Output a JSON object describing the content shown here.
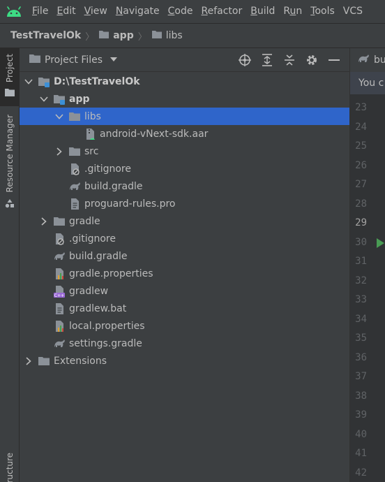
{
  "menu": {
    "items": [
      {
        "label": "File",
        "mnemonic": "F",
        "rest": "ile"
      },
      {
        "label": "Edit",
        "mnemonic": "E",
        "rest": "dit"
      },
      {
        "label": "View",
        "mnemonic": "V",
        "rest": "iew"
      },
      {
        "label": "Navigate",
        "mnemonic": "N",
        "rest": "avigate"
      },
      {
        "label": "Code",
        "mnemonic": "C",
        "rest": "ode"
      },
      {
        "label": "Refactor",
        "mnemonic": "R",
        "rest": "efactor"
      },
      {
        "label": "Build",
        "mnemonic": "B",
        "rest": "uild"
      },
      {
        "label": "Run",
        "pre": "R",
        "mnemonic": "u",
        "rest": "n"
      },
      {
        "label": "Tools",
        "mnemonic": "T",
        "rest": "ools"
      },
      {
        "label": "VCS",
        "mnemonic": "",
        "rest": "VCS"
      }
    ]
  },
  "breadcrumb": {
    "project": "TestTravelOk",
    "module": "app",
    "folder": "libs"
  },
  "toolstrip": {
    "project_tab": "Project",
    "resource_manager_tab": "Resource Manager",
    "structure_tab": "ructure"
  },
  "panel": {
    "title": "Project Files"
  },
  "tree": [
    {
      "label": "D:\\TestTravelOk",
      "bold": true,
      "depth": 0,
      "chevron": "open",
      "icon": "module-folder-icon"
    },
    {
      "label": "app",
      "bold": true,
      "depth": 1,
      "chevron": "open",
      "icon": "module-folder-icon"
    },
    {
      "label": "libs",
      "bold": false,
      "depth": 2,
      "chevron": "open",
      "icon": "folder-icon",
      "selected": true
    },
    {
      "label": "android-vNext-sdk.aar",
      "bold": false,
      "depth": 3,
      "chevron": "none",
      "icon": "archive-file-icon"
    },
    {
      "label": "src",
      "bold": false,
      "depth": 2,
      "chevron": "closed",
      "icon": "folder-icon"
    },
    {
      "label": ".gitignore",
      "bold": false,
      "depth": 2,
      "chevron": "none",
      "icon": "ignore-file-icon"
    },
    {
      "label": "build.gradle",
      "bold": false,
      "depth": 2,
      "chevron": "none",
      "icon": "gradle-icon"
    },
    {
      "label": "proguard-rules.pro",
      "bold": false,
      "depth": 2,
      "chevron": "none",
      "icon": "text-file-icon"
    },
    {
      "label": "gradle",
      "bold": false,
      "depth": 1,
      "chevron": "closed",
      "icon": "folder-icon"
    },
    {
      "label": ".gitignore",
      "bold": false,
      "depth": 1,
      "chevron": "none",
      "icon": "ignore-file-icon"
    },
    {
      "label": "build.gradle",
      "bold": false,
      "depth": 1,
      "chevron": "none",
      "icon": "gradle-icon"
    },
    {
      "label": "gradle.properties",
      "bold": false,
      "depth": 1,
      "chevron": "none",
      "icon": "properties-file-icon"
    },
    {
      "label": "gradlew",
      "bold": false,
      "depth": 1,
      "chevron": "none",
      "icon": "script-file-icon"
    },
    {
      "label": "gradlew.bat",
      "bold": false,
      "depth": 1,
      "chevron": "none",
      "icon": "text-file-icon"
    },
    {
      "label": "local.properties",
      "bold": false,
      "depth": 1,
      "chevron": "none",
      "icon": "properties-file-icon"
    },
    {
      "label": "settings.gradle",
      "bold": false,
      "depth": 1,
      "chevron": "none",
      "icon": "gradle-icon"
    },
    {
      "label": "Extensions",
      "bold": false,
      "depth": 0,
      "chevron": "closed",
      "icon": "folder-icon"
    }
  ],
  "editor": {
    "tab_label": "bu",
    "notice": "You c",
    "line_numbers": [
      "23",
      "24",
      "25",
      "26",
      "27",
      "28",
      "29",
      "30",
      "31",
      "32",
      "33",
      "34",
      "35",
      "36",
      "37",
      "38",
      "39",
      "40",
      "41",
      "42"
    ],
    "current_line": "29",
    "run_line": "30"
  },
  "colors": {
    "selection": "#2f65ca",
    "panel_bg": "#3c3f41",
    "editor_bg": "#2b2b2b",
    "android_green": "#3ddc84",
    "run_green": "#499c54"
  }
}
